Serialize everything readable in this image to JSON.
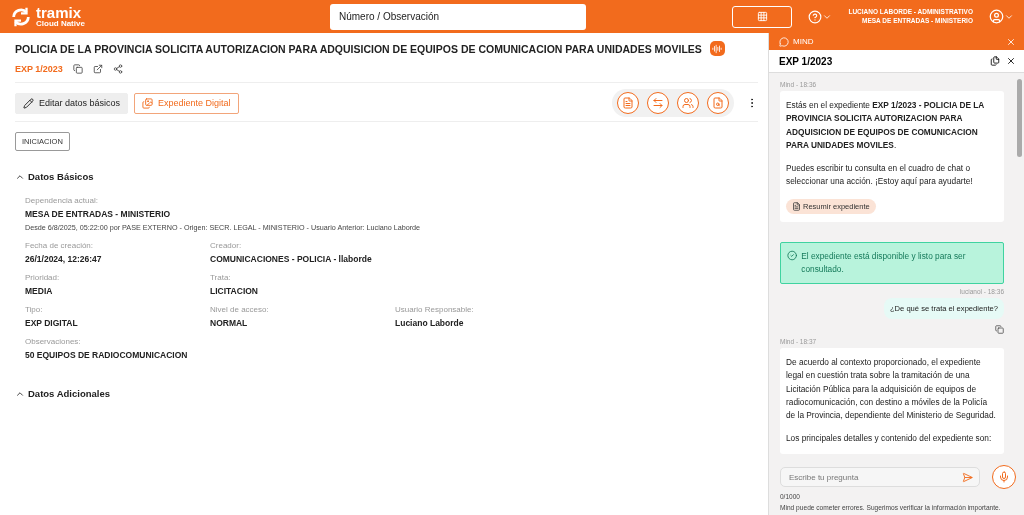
{
  "header": {
    "logo_name": "tramix",
    "logo_sub": "Cloud Native",
    "search": {
      "placeholder": "Número / Observación"
    },
    "user_lines": [
      "LUCIANO LABORDE - ADMINISTRATIVO",
      "MESA DE ENTRADAS - MINISTERIO"
    ]
  },
  "expediente": {
    "title": "POLICIA DE LA PROVINCIA SOLICITA AUTORIZACION PARA ADQUISICION DE EQUIPOS DE COMUNICACION PARA UNIDADES MOVILES",
    "number": "EXP 1/2023",
    "buttons": [
      {
        "kind": "edit",
        "label": "Editar datos básicos"
      },
      {
        "kind": "digital",
        "label": "Expediente Digital"
      }
    ],
    "stage": "INICIACION"
  },
  "sections": [
    {
      "title": "Datos Básicos",
      "expanded": true,
      "rows": [
        [
          {
            "label": "Dependencia actual:",
            "value": "MESA DE ENTRADAS - MINISTERIO",
            "note": "Desde 6/8/2025, 05:22:00 por PASE EXTERNO - Origen: SECR. LEGAL - MINISTERIO - Usuario Anterior: Luciano Laborde"
          }
        ],
        [
          {
            "label": "Fecha de creación:",
            "value": "26/1/2024, 12:26:47"
          },
          {
            "label": "Creador:",
            "value": "COMUNICACIONES - POLICIA - llaborde"
          }
        ],
        [
          {
            "label": "Prioridad:",
            "value": "MEDIA"
          },
          {
            "label": "Trata:",
            "value": "LICITACION"
          }
        ],
        [
          {
            "label": "Tipo:",
            "value": "EXP DIGITAL"
          },
          {
            "label": "Nivel de acceso:",
            "value": "NORMAL"
          },
          {
            "label": "Usuario Responsable:",
            "value": "Luciano Laborde"
          }
        ],
        [
          {
            "label": "Observaciones:",
            "value": "50 EQUIPOS DE RADIOCOMUNICACION"
          }
        ]
      ]
    },
    {
      "title": "Datos Adicionales",
      "expanded": true
    }
  ],
  "chat": {
    "title": "MIND",
    "subject": "EXP 1/2023",
    "messages": [
      {
        "kind": "bot",
        "meta": "Mind - 18:36",
        "paragraphs": [
          "Estás en el expediente **EXP 1/2023 - POLICIA DE LA PROVINCIA SOLICITA AUTORIZACION PARA ADQUISICION DE EQUIPOS DE COMUNICACION PARA UNIDADES MOVILES**.",
          "Puedes escribir tu consulta en el cuadro de chat o seleccionar una acción. ¡Estoy aquí para ayudarte!"
        ],
        "action": "Resumir expediente"
      },
      {
        "kind": "status",
        "text": "El expediente está disponible y listo para ser consultado."
      },
      {
        "kind": "user",
        "meta": "lucianol - 18:36",
        "text": "¿De qué se trata el expediente?"
      },
      {
        "kind": "bot",
        "meta": "Mind - 18:37",
        "paragraphs": [
          "De acuerdo al contexto proporcionado, el expediente legal en cuestión trata sobre la tramitación de una Licitación Pública para la adquisición de equipos de radiocomunicación, con destino a móviles de la Policía de la Provincia, dependiente del Ministerio de Seguridad.",
          "Los principales detalles y contenido del expediente son:"
        ]
      }
    ],
    "input": {
      "placeholder": "Escribe tu pregunta"
    },
    "counter": "0/1000",
    "disclaimer": "Mind puede cometer errores. Sugerimos verificar la información importante."
  }
}
